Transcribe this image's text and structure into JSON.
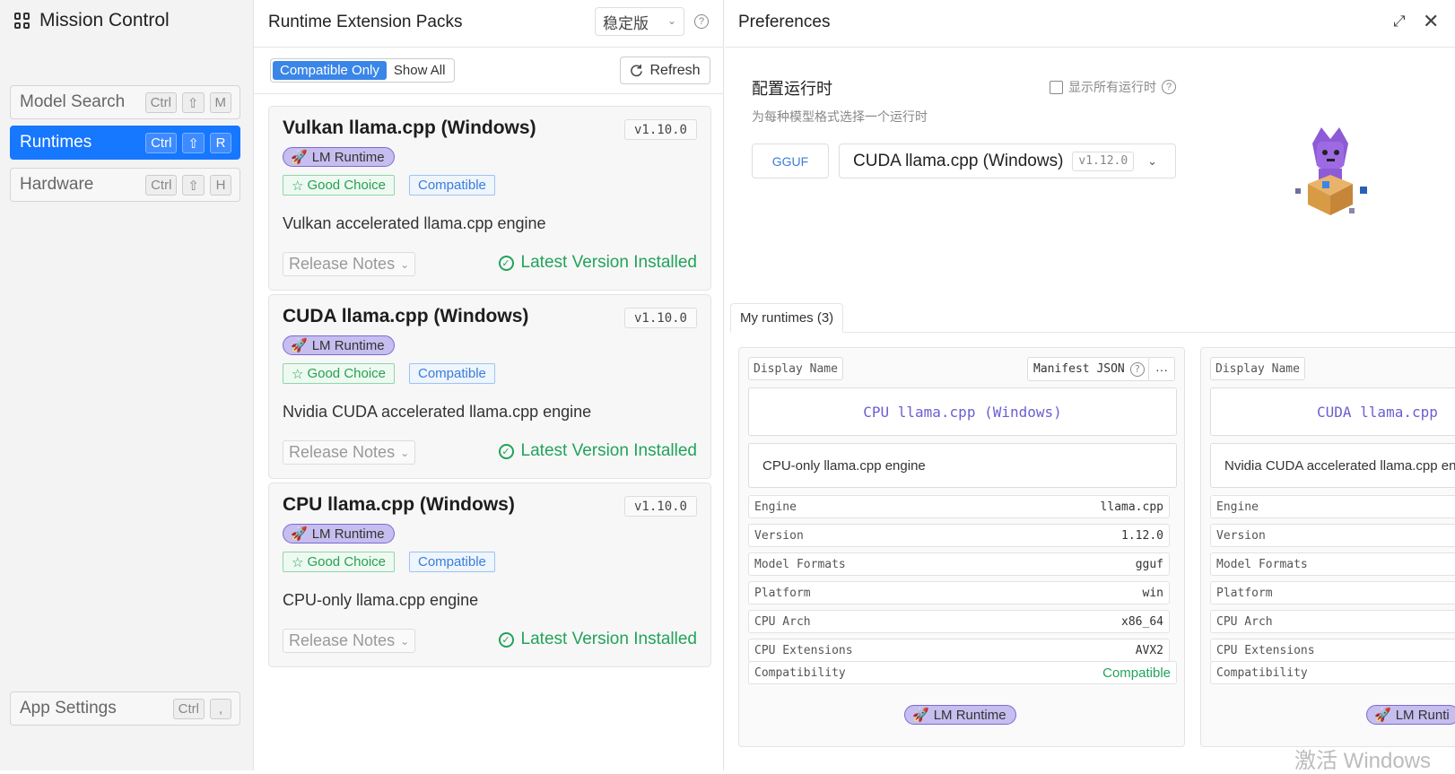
{
  "sidebar": {
    "title": "Mission Control",
    "items": [
      {
        "label": "Model Search",
        "keys": [
          "Ctrl",
          "⇧",
          "M"
        ],
        "active": false
      },
      {
        "label": "Runtimes",
        "keys": [
          "Ctrl",
          "⇧",
          "R"
        ],
        "active": true
      },
      {
        "label": "Hardware",
        "keys": [
          "Ctrl",
          "⇧",
          "H"
        ],
        "active": false
      }
    ],
    "settings": {
      "label": "App Settings",
      "keys": [
        "Ctrl",
        ","
      ]
    }
  },
  "packs": {
    "title": "Runtime Extension Packs",
    "channel": "稳定版",
    "filters": {
      "compatible_only": "Compatible Only",
      "show_all": "Show All"
    },
    "refresh_label": "Refresh",
    "items": [
      {
        "name": "Vulkan llama.cpp (Windows)",
        "version": "v1.10.0",
        "badge": "LM Runtime",
        "good": "Good Choice",
        "compat": "Compatible",
        "description": "Vulkan accelerated llama.cpp engine",
        "notes": "Release Notes",
        "status": "Latest Version Installed"
      },
      {
        "name": "CUDA llama.cpp (Windows)",
        "version": "v1.10.0",
        "badge": "LM Runtime",
        "good": "Good Choice",
        "compat": "Compatible",
        "description": "Nvidia CUDA accelerated llama.cpp engine",
        "notes": "Release Notes",
        "status": "Latest Version Installed"
      },
      {
        "name": "CPU llama.cpp (Windows)",
        "version": "v1.10.0",
        "badge": "LM Runtime",
        "good": "Good Choice",
        "compat": "Compatible",
        "description": "CPU-only llama.cpp engine",
        "notes": "Release Notes",
        "status": "Latest Version Installed"
      }
    ]
  },
  "preferences": {
    "title": "Preferences",
    "config_title": "配置运行时",
    "config_subtitle": "为每种模型格式选择一个运行时",
    "show_all_label": "显示所有运行时",
    "format": "GGUF",
    "selected_runtime": "CUDA llama.cpp (Windows)",
    "selected_version": "v1.12.0",
    "tab_label": "My runtimes (3)",
    "runtimes": [
      {
        "display_label": "Display Name",
        "manifest_label": "Manifest JSON",
        "more_label": "···",
        "display_name": "CPU llama.cpp (Windows)",
        "description": "CPU-only llama.cpp engine",
        "props": [
          {
            "k": "Engine",
            "v": "llama.cpp"
          },
          {
            "k": "Version",
            "v": "1.12.0"
          },
          {
            "k": "Model Formats",
            "v": "gguf"
          },
          {
            "k": "Platform",
            "v": "win"
          },
          {
            "k": "CPU Arch",
            "v": "x86_64"
          },
          {
            "k": "CPU Extensions",
            "v": "AVX2"
          },
          {
            "k": "Compatibility",
            "v": "Compatible"
          }
        ],
        "badge": "LM Runtime"
      },
      {
        "display_label": "Display Name",
        "display_name": "CUDA llama.cpp",
        "description": "Nvidia CUDA accelerated llama.cpp eng",
        "props": [
          {
            "k": "Engine",
            "v": ""
          },
          {
            "k": "Version",
            "v": ""
          },
          {
            "k": "Model Formats",
            "v": ""
          },
          {
            "k": "Platform",
            "v": ""
          },
          {
            "k": "CPU Arch",
            "v": ""
          },
          {
            "k": "CPU Extensions",
            "v": ""
          },
          {
            "k": "Compatibility",
            "v": ""
          }
        ],
        "badge": "LM Runti"
      }
    ]
  },
  "watermark": "激活 Windows",
  "colors": {
    "accent": "#1677ff",
    "good": "#22a35a",
    "runtime_badge": "#c5beee",
    "link_blue": "#3a7dd8"
  }
}
